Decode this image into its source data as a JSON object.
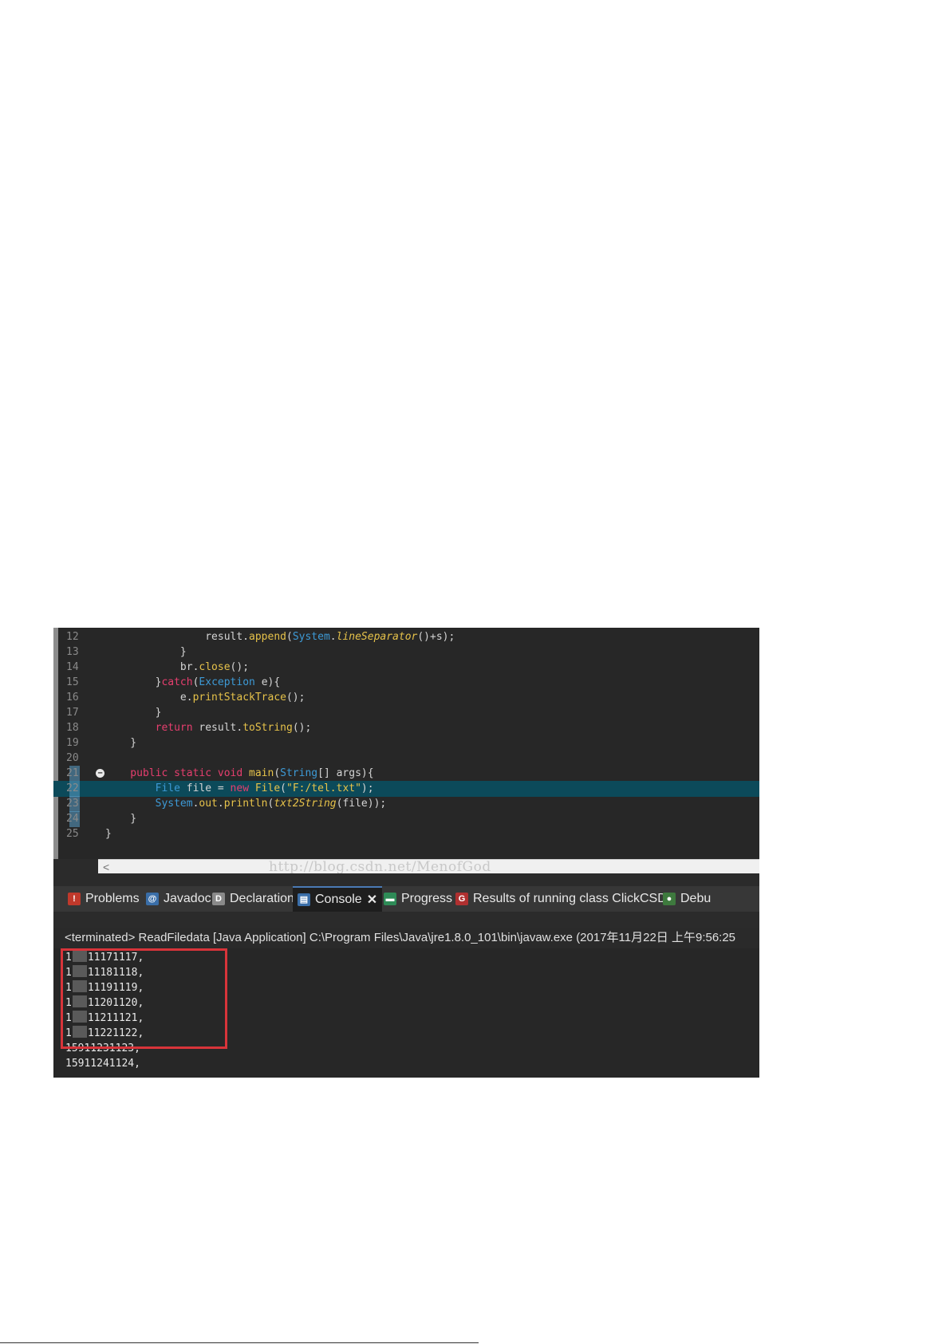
{
  "editor": {
    "lines": [
      {
        "num": "12",
        "tokens": [
          [
            "pl",
            "                result."
          ],
          [
            "fn",
            "append"
          ],
          [
            "pl",
            "("
          ],
          [
            "ty",
            "System"
          ],
          [
            "pl",
            "."
          ],
          [
            "it",
            "lineSeparator"
          ],
          [
            "pl",
            "()+s);"
          ]
        ]
      },
      {
        "num": "13",
        "tokens": [
          [
            "pl",
            "            }"
          ]
        ]
      },
      {
        "num": "14",
        "tokens": [
          [
            "pl",
            "            br."
          ],
          [
            "fn",
            "close"
          ],
          [
            "pl",
            "();"
          ]
        ]
      },
      {
        "num": "15",
        "tokens": [
          [
            "pl",
            "        }"
          ],
          [
            "kw",
            "catch"
          ],
          [
            "pl",
            "("
          ],
          [
            "ty",
            "Exception"
          ],
          [
            "pl",
            " e){"
          ]
        ]
      },
      {
        "num": "16",
        "tokens": [
          [
            "pl",
            "            e."
          ],
          [
            "fn",
            "printStackTrace"
          ],
          [
            "pl",
            "();"
          ]
        ]
      },
      {
        "num": "17",
        "tokens": [
          [
            "pl",
            "        }"
          ]
        ]
      },
      {
        "num": "18",
        "tokens": [
          [
            "kw",
            "        return"
          ],
          [
            "pl",
            " result."
          ],
          [
            "fn",
            "toString"
          ],
          [
            "pl",
            "();"
          ]
        ]
      },
      {
        "num": "19",
        "tokens": [
          [
            "pl",
            "    }"
          ]
        ]
      },
      {
        "num": "20",
        "tokens": []
      },
      {
        "num": "21",
        "tokens": [
          [
            "kw",
            "    public static void "
          ],
          [
            "fn",
            "main"
          ],
          [
            "pl",
            "("
          ],
          [
            "ty",
            "String"
          ],
          [
            "pl",
            "[] args){"
          ]
        ]
      },
      {
        "num": "22",
        "tokens": [
          [
            "ty",
            "        File"
          ],
          [
            "pl",
            " file = "
          ],
          [
            "kw",
            "new "
          ],
          [
            "fn",
            "File"
          ],
          [
            "pl",
            "("
          ],
          [
            "st",
            "\"F:/tel.txt\""
          ],
          [
            "pl",
            ");"
          ]
        ]
      },
      {
        "num": "23",
        "tokens": [
          [
            "ty",
            "        System"
          ],
          [
            "pl",
            "."
          ],
          [
            "fn",
            "out"
          ],
          [
            "pl",
            "."
          ],
          [
            "fn",
            "println"
          ],
          [
            "pl",
            "("
          ],
          [
            "it",
            "txt2String"
          ],
          [
            "pl",
            "(file));"
          ]
        ]
      },
      {
        "num": "24",
        "tokens": [
          [
            "pl",
            "    }"
          ]
        ]
      },
      {
        "num": "25",
        "tokens": [
          [
            "pl",
            "}"
          ]
        ]
      }
    ],
    "watermark": "http://blog.csdn.net/MenofGod"
  },
  "tabs": [
    {
      "label": "Problems",
      "icon": "problems-icon",
      "color": "#c0392b",
      "glyph": "!"
    },
    {
      "label": "Javadoc",
      "icon": "javadoc-icon",
      "color": "#3a6ea8",
      "glyph": "@"
    },
    {
      "label": "Declaration",
      "icon": "declaration-icon",
      "color": "#8a8a8a",
      "glyph": "D"
    },
    {
      "label": "Console",
      "icon": "console-icon",
      "color": "#3a6ea8",
      "glyph": "▤",
      "close": "✕"
    },
    {
      "label": "Progress",
      "icon": "progress-icon",
      "color": "#2e8b57",
      "glyph": "▬"
    },
    {
      "label": "Results of running class ClickCSDN",
      "icon": "junit-results-icon",
      "color": "#b03030",
      "glyph": "G"
    },
    {
      "label": "Debu",
      "icon": "debug-icon",
      "color": "#3e7a3e",
      "glyph": "●"
    }
  ],
  "console": {
    "status": "<terminated> ReadFiledata [Java Application] C:\\Program Files\\Java\\jre1.8.0_101\\bin\\javaw.exe (2017年11月22日 上午9:56:25",
    "output": [
      {
        "prefix": "1",
        "masked": true,
        "rest": "11171117,"
      },
      {
        "prefix": "1",
        "masked": true,
        "rest": "11181118,"
      },
      {
        "prefix": "1",
        "masked": true,
        "rest": "11191119,"
      },
      {
        "prefix": "1",
        "masked": true,
        "rest": "11201120,"
      },
      {
        "prefix": "1",
        "masked": true,
        "rest": "11211121,"
      },
      {
        "prefix": "1",
        "masked": true,
        "rest": "11221122,"
      },
      {
        "prefix": "15911231123,",
        "masked": false,
        "rest": ""
      },
      {
        "prefix": "15911241124,",
        "masked": false,
        "rest": ""
      }
    ]
  },
  "colors": {
    "highlight": "#d8343a",
    "editor_bg": "#272727",
    "current_line": "#0c4a5a"
  }
}
